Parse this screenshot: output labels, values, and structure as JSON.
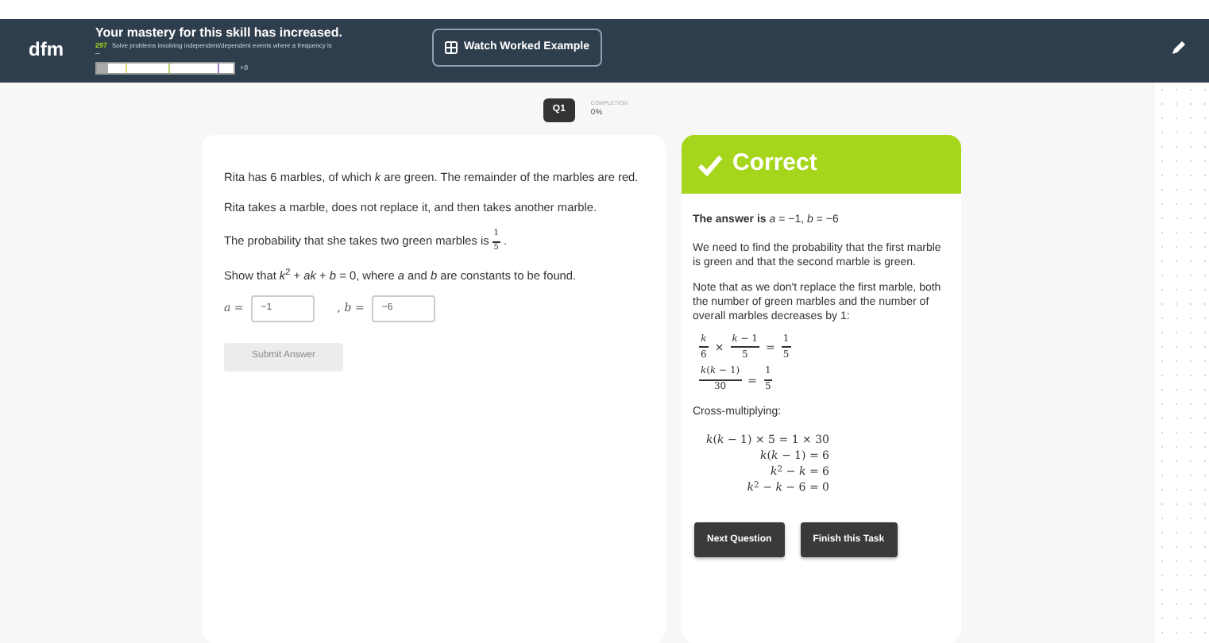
{
  "header": {
    "logo": "dfm",
    "title": "Your mastery for this skill has increased.",
    "skill_code": "297",
    "skill_description": "Solve problems involving independent/dependent events where a frequency is",
    "skill_continuation": "–",
    "mastery": {
      "level": 0.08
    },
    "mastery_gain": "+8",
    "watch_button": "Watch Worked Example"
  },
  "question_tab": {
    "label": "Q1",
    "completion_label": "COMPLETION",
    "completion_value": "0%"
  },
  "question": {
    "paragraphs": [
      [
        {
          "kind": "text",
          "text": "Rita has 6 marbles, of which *k* are green. The remainder of the marbles are red."
        }
      ],
      [
        {
          "kind": "text",
          "text": "Rita takes a marble, does not replace it, and then takes another marble."
        }
      ],
      [
        {
          "kind": "text",
          "text": "The probability that she takes two green marbles is "
        },
        {
          "kind": "fraction",
          "num": "1",
          "den": "5"
        },
        {
          "kind": "text",
          "text": "."
        }
      ],
      [
        {
          "kind": "text",
          "text": "Show that *k*$^{2}$ + *ak* + *b* = 0, where *a* and *b* are constants to be found."
        }
      ]
    ],
    "fields": [
      {
        "label": "*a* =",
        "value": "−1"
      },
      {
        "label": ", *b* =",
        "value": "−6"
      }
    ],
    "submit_button": {
      "label": "Submit Answer",
      "disabled": true
    }
  },
  "feedback": {
    "verdict": "Correct",
    "answer": "**The answer is** *a* = −1, *b* = −6",
    "paragraphs": [
      "We need to find the probability that the first marble is green and that the second marble is green.",
      "Note that as we don't replace the first marble, both the number of green marbles and the number of overall marbles decreases by 1:"
    ],
    "working": [
      [
        {
          "kind": "fraction",
          "num": "*k*",
          "den": "6"
        },
        {
          "kind": "text",
          "text": "×"
        },
        {
          "kind": "fraction",
          "num": "*k* − 1",
          "den": "5"
        },
        {
          "kind": "text",
          "text": "="
        },
        {
          "kind": "fraction",
          "num": "1",
          "den": "5"
        }
      ],
      [
        {
          "kind": "fraction",
          "num": "*k*(*k* − 1)",
          "den": "30"
        },
        {
          "kind": "text",
          "text": "="
        },
        {
          "kind": "fraction",
          "num": "1",
          "den": "5"
        }
      ]
    ],
    "step_label": "Cross-multiplying:",
    "equations": [
      "*k*(*k* − 1) × 5 = 1 × 30",
      "*k*(*k* − 1) = 6",
      "*k*$^{2}$ − *k* = 6",
      "*k*$^{2}$ − *k* − 6 = 0"
    ],
    "buttons": [
      "Next Question",
      "Finish this Task"
    ]
  }
}
